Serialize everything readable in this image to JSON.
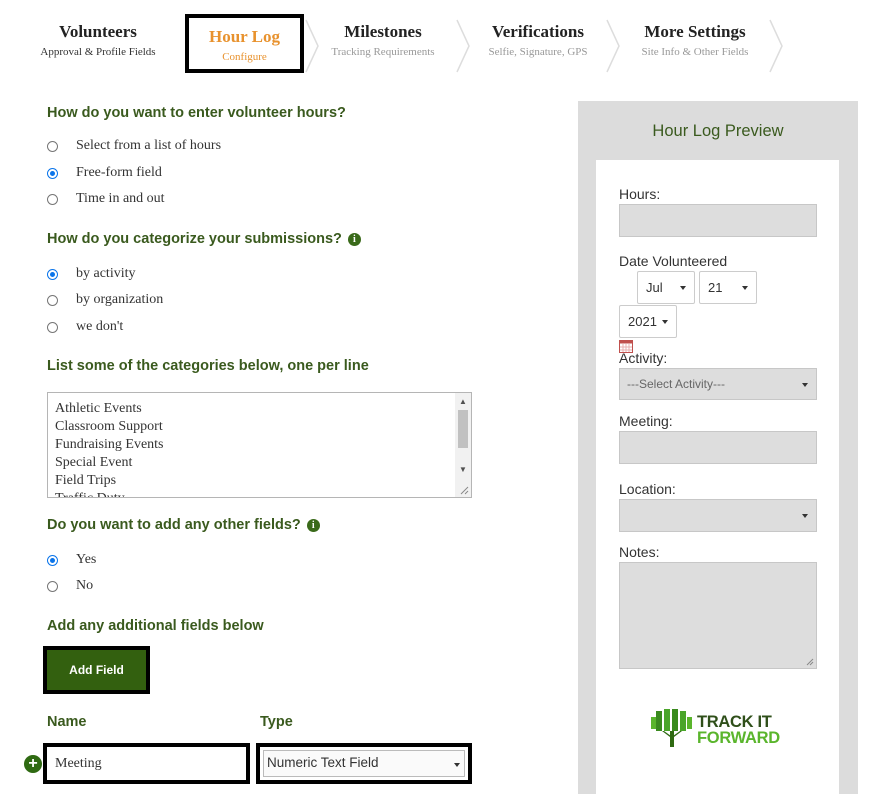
{
  "steps": [
    {
      "title": "Volunteers",
      "subtitle": "Approval & Profile Fields"
    },
    {
      "title": "Hour Log",
      "subtitle": "Configure"
    },
    {
      "title": "Milestones",
      "subtitle": "Tracking Requirements"
    },
    {
      "title": "Verifications",
      "subtitle": "Selfie, Signature, GPS"
    },
    {
      "title": "More Settings",
      "subtitle": "Site Info & Other Fields"
    }
  ],
  "active_step": "Hour Log",
  "q_entry": {
    "question": "How do you want to enter volunteer hours?",
    "options": [
      "Select from a list of hours",
      "Free-form field",
      "Time in and out"
    ],
    "selected": "Free-form field"
  },
  "q_categorize": {
    "question": "How do you categorize your submissions?",
    "options": [
      "by activity",
      "by organization",
      "we don't"
    ],
    "selected": "by activity"
  },
  "categories": {
    "question": "List some of the categories below, one per line",
    "lines": [
      "Athletic Events",
      "Classroom Support",
      "Fundraising Events",
      "Special Event",
      "Field Trips",
      "Traffic Duty"
    ]
  },
  "q_other_fields": {
    "question": "Do you want to add any other fields?",
    "options": [
      "Yes",
      "No"
    ],
    "selected": "Yes"
  },
  "additional": {
    "heading": "Add any additional fields below",
    "add_button": "Add Field",
    "name_header": "Name",
    "type_header": "Type",
    "field_name": "Meeting",
    "field_type": "Numeric Text Field"
  },
  "preview": {
    "title": "Hour Log Preview",
    "hours_label": "Hours:",
    "date_label": "Date Volunteered",
    "month": "Jul",
    "day": "21",
    "year": "2021",
    "activity_label": "Activity:",
    "activity_placeholder": "---Select Activity---",
    "meeting_label": "Meeting:",
    "location_label": "Location:",
    "notes_label": "Notes:",
    "logo_line1": "TRACK IT",
    "logo_line2": "FORWARD"
  },
  "colors": {
    "accent_orange": "#e8922e",
    "heading_green": "#3a5a1e",
    "button_green": "#33600f",
    "radio_blue": "#0a74ea",
    "logo_light_green": "#5ab52c"
  },
  "icons": [
    "info-icon",
    "calendar-icon",
    "plus-circle-icon",
    "tree-logo-icon",
    "chevron-separator-icon"
  ]
}
